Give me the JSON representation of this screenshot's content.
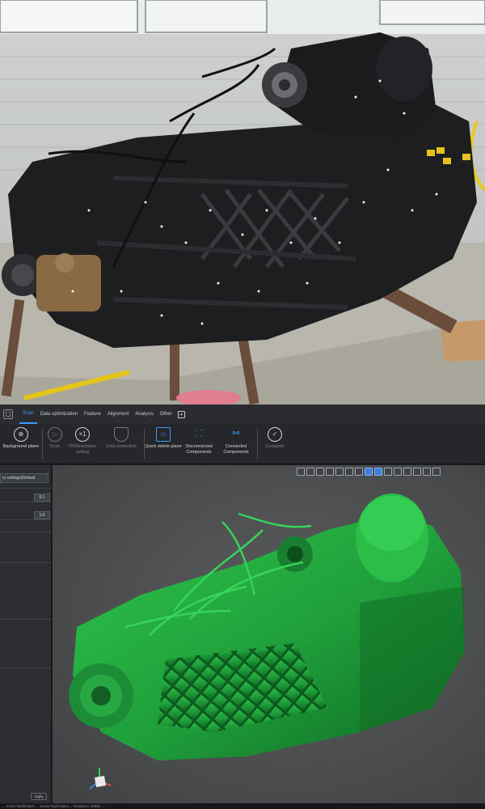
{
  "tabs": [
    "Scan",
    "Data optimization",
    "Feature",
    "Alignment",
    "Analysis",
    "Other"
  ],
  "active_tab_index": 0,
  "ribbon": {
    "buttons": [
      {
        "label": "Background plane",
        "icon": "crosshair-icon",
        "enabled": true
      },
      {
        "label": "Scan",
        "icon": "play-icon",
        "enabled": false
      },
      {
        "label": "FR/Resolution setting",
        "icon": "resolution-icon",
        "enabled": false
      },
      {
        "label": "Data protection",
        "icon": "shield-icon",
        "enabled": false
      },
      {
        "label": "Quick delete plane",
        "icon": "plane-delete-icon",
        "enabled": true
      },
      {
        "label": "Disconnected Components",
        "icon": "disconnected-icon",
        "enabled": true
      },
      {
        "label": "Connected Components",
        "icon": "connected-icon",
        "enabled": true
      },
      {
        "label": "Complete",
        "icon": "check-circle-icon",
        "enabled": false
      }
    ],
    "resolution_badge": "×1"
  },
  "sidebar": {
    "preset": "ry settings(Default",
    "value_1": "0.1",
    "value_2": "1.0",
    "apply_label": "Apply"
  },
  "statusbar": {
    "text": "... Select Modification ... mouse Right button ... translation, Middle ..."
  },
  "colors": {
    "accent": "#3d9bff",
    "mesh": "#1f9e3a",
    "viewport_bg": "#505153"
  },
  "viewport_toolbar_icons": [
    "select-icon",
    "lasso-icon",
    "rect-select-icon",
    "view-front-icon",
    "view-iso-icon",
    "view-top-icon",
    "rotate-icon",
    "mesh-icon",
    "points-icon",
    "texture-icon",
    "hide-icon",
    "show-icon",
    "color-icon",
    "shade-icon",
    "export-icon"
  ]
}
